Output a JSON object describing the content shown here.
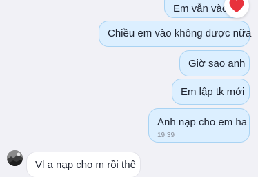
{
  "conversation": {
    "messages": [
      {
        "direction": "out",
        "text": "Em vẫn vào"
      },
      {
        "direction": "out",
        "text": "Chiều em vào không được nữa"
      },
      {
        "direction": "out",
        "text": "Giờ sao anh"
      },
      {
        "direction": "out",
        "text": "Em lập tk mới"
      },
      {
        "direction": "out",
        "text": "Anh nạp cho em ha",
        "time": "19:39"
      },
      {
        "direction": "in",
        "text": "Vl a nạp cho m rồi thê"
      }
    ],
    "reaction": {
      "icon": "red-heart-icon",
      "color": "#e8323c"
    }
  },
  "theme": {
    "background": "#f1f1f6",
    "outgoing_bubble": "#dcefff",
    "outgoing_border": "#a9d3f3",
    "incoming_bubble": "#ffffff"
  }
}
